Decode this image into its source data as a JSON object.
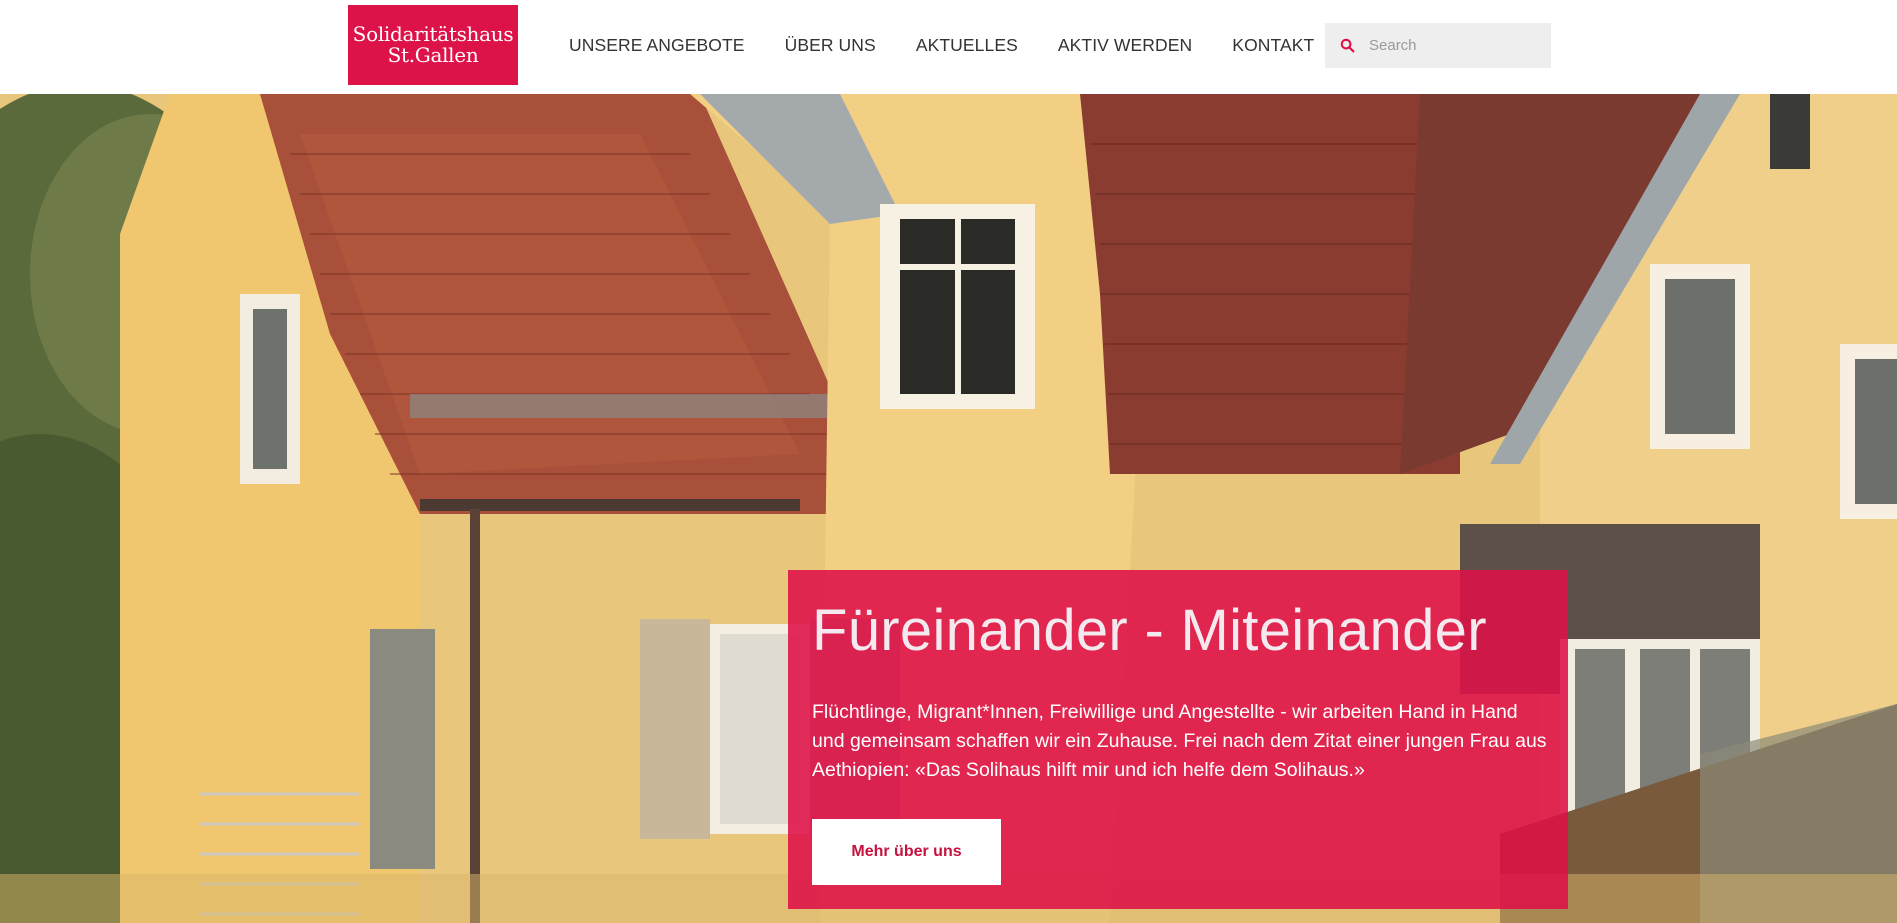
{
  "header": {
    "logo": {
      "line1": "Solidaritätshaus",
      "line2": "St.Gallen"
    },
    "nav": [
      {
        "label": "UNSERE ANGEBOTE"
      },
      {
        "label": "ÜBER UNS"
      },
      {
        "label": "AKTUELLES"
      },
      {
        "label": "AKTIV WERDEN"
      },
      {
        "label": "KONTAKT"
      }
    ],
    "search": {
      "placeholder": "Search",
      "icon": "search-icon"
    }
  },
  "hero": {
    "title": "Füreinander - Miteinander",
    "text": "Flüchtlinge, Migrant*Innen, Freiwillige und Angestellte - wir arbeiten Hand in Hand und gemeinsam schaffen wir ein Zuhause. Frei nach dem Zitat einer jungen Frau aus Aethiopien: «Das Solihaus hilft mir und ich helfe dem Solihaus.»",
    "button_label": "Mehr über uns"
  },
  "colors": {
    "brand": "#dd1248",
    "nav_text": "#333333",
    "search_bg": "#eeeeef"
  }
}
